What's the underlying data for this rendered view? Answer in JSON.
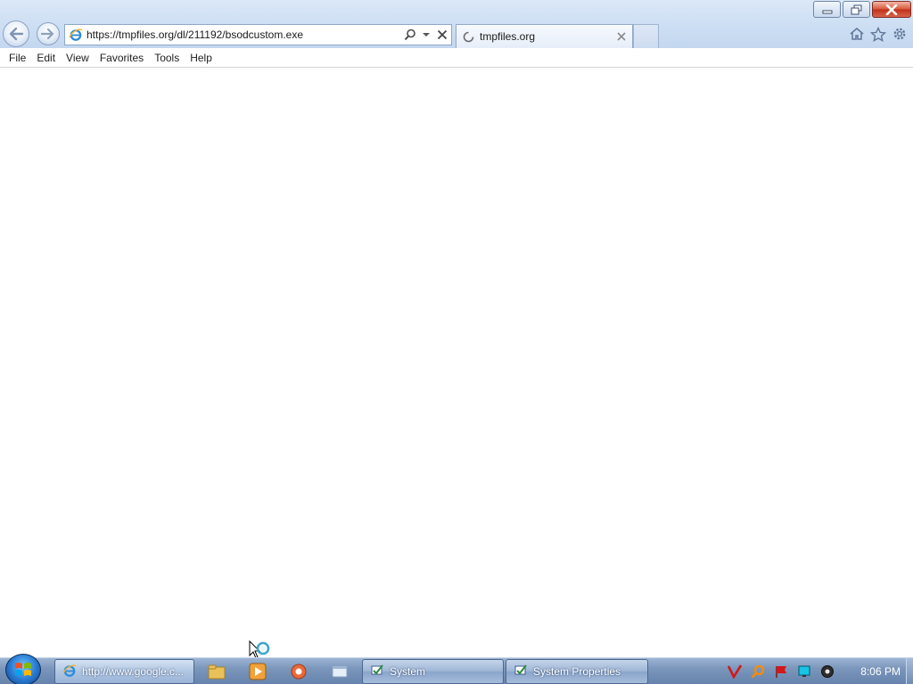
{
  "window": {
    "controls": {
      "minimize": "minimize",
      "maximize": "restore",
      "close": "close"
    }
  },
  "nav": {
    "back_icon": "back-arrow-icon",
    "forward_icon": "forward-arrow-icon"
  },
  "address": {
    "url": "https://tmpfiles.org/dl/211192/bsodcustom.exe",
    "icons": [
      "ie-icon",
      "search-icon",
      "dropdown-icon",
      "stop-icon"
    ]
  },
  "tabs": [
    {
      "label": "tmpfiles.org",
      "loading": true,
      "active": true
    }
  ],
  "toolbar_right": [
    "home-icon",
    "favorites-star-icon",
    "tools-gear-icon"
  ],
  "menubar": {
    "items": [
      "File",
      "Edit",
      "View",
      "Favorites",
      "Tools",
      "Help"
    ]
  },
  "taskbar": {
    "buttons": [
      {
        "label": "http://www.google.c...",
        "icon": "ie-icon"
      },
      {
        "label": "System",
        "icon": "system-icon"
      },
      {
        "label": "System Properties",
        "icon": "system-properties-icon"
      }
    ],
    "quick_launch": [
      "explorer-icon",
      "media-player-icon",
      "app-icon",
      "window-icon"
    ],
    "tray": [
      "v-antivirus-icon",
      "search-tray-icon",
      "flag-icon",
      "network-icon",
      "volume-icon"
    ],
    "clock": "8:06 PM"
  },
  "colors": {
    "accent": "#3b6bb5",
    "close_red": "#c0311a",
    "taskbar": "#6683ad"
  }
}
